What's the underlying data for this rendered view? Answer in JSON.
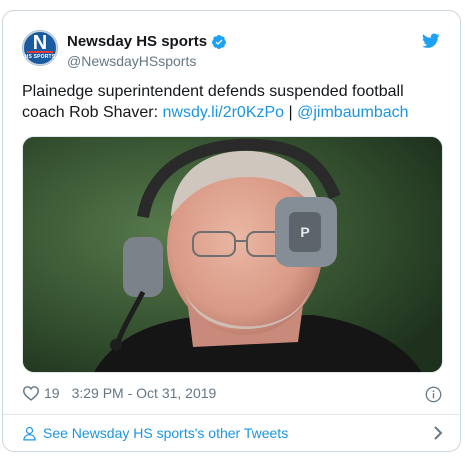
{
  "tweet": {
    "author_name": "Newsday HS sports",
    "author_handle": "@NewsdayHSsports",
    "avatar_letter": "N",
    "avatar_sub": "HS SPORTS",
    "text_main": "Plainedge superintendent defends suspended football coach Rob Shaver: ",
    "link1": "nwsdy.li/2r0KzPo",
    "separator": " | ",
    "mention": "@jimbaumbach",
    "likes": "19",
    "timestamp": "3:29 PM - Oct 31, 2019",
    "other_tweets_label": "See Newsday HS sports's other Tweets"
  },
  "colors": {
    "brand_blue": "#1b95e0",
    "verified_blue": "#1da1f2",
    "avatar_bg": "#1a5a9e"
  },
  "icons": {
    "verified": "verified-badge-icon",
    "bird": "twitter-bird-icon",
    "heart": "heart-icon",
    "info": "info-icon",
    "person": "person-icon",
    "chevron": "chevron-right-icon"
  }
}
